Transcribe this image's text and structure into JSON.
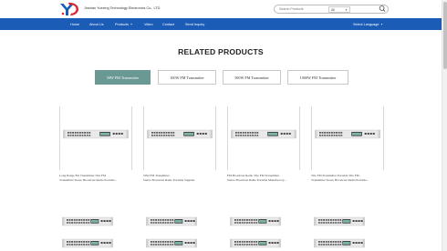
{
  "header": {
    "company_name": "Jinshan Yuexing Technology Electronics Co., LTD",
    "search_placeholder": "Search Products",
    "search_scope": "All"
  },
  "nav": {
    "items": [
      "Home",
      "About Us",
      "Products",
      "Video",
      "Contact",
      "Send Inquiry"
    ],
    "language": "Select Language"
  },
  "main": {
    "section_title": "RELATED PRODUCTS",
    "tabs": [
      "50W FM Transmitter",
      "100W FM Transmitter",
      "500W FM Transmitter",
      "1000W FM Transmitter"
    ],
    "active_tab": "50W FM Transmitter",
    "products": [
      {
        "title_line1": "Long Range Fm Transmitter 50w FM",
        "title_line2": "Transmitter Stereo Broadcast Radio Portable..."
      },
      {
        "title_line1": "50W FM Transmitter",
        "title_line2": "Stereo Broadcast Radio Portable Supplier"
      },
      {
        "title_line1": "FM Broadcast Radio 50w FM Transmitter",
        "title_line2": "Stereo Broadcast Radio Portable Manufactory..."
      },
      {
        "title_line1": "50w FM Transmitter Portable 50w FM",
        "title_line2": "Transmitter Stereo Broadcast Radio Portable..."
      }
    ]
  },
  "colors": {
    "nav_bg": "#1b5cb7",
    "active_tab_bg": "#6a9893",
    "logo_red": "#d9262c",
    "logo_blue": "#1b5cb7"
  }
}
